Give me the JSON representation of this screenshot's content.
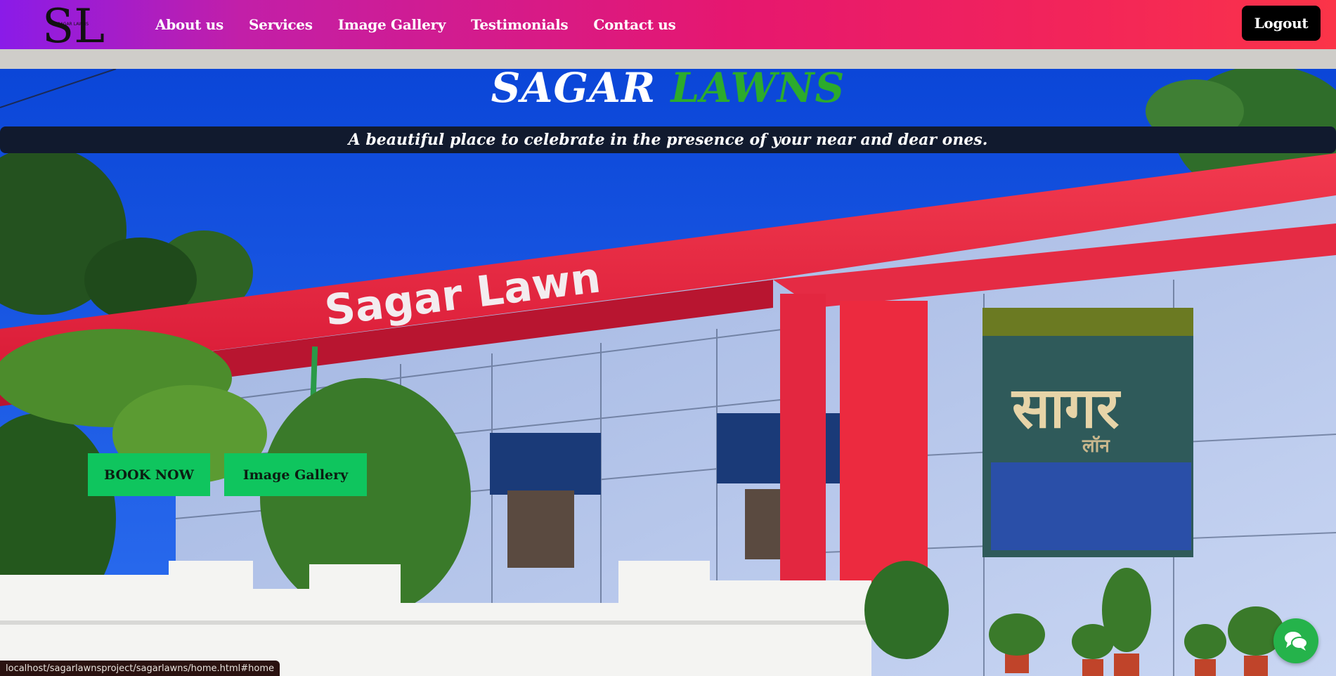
{
  "brand": {
    "logo_letters": "SL",
    "logo_text": "SAGAR LAWNS"
  },
  "nav": {
    "links": [
      "About us",
      "Services",
      "Image Gallery",
      "Testimonials",
      "Contact us"
    ],
    "logout_label": "Logout"
  },
  "hero": {
    "title_part1": "SAGAR",
    "title_part2": "LAWNS",
    "tagline": "A beautiful place to celebrate in the presence of your near and dear ones.",
    "building_sign": "Sagar Lawn",
    "hindi_sign_main": "सागर",
    "hindi_sign_sub": "लॉन",
    "book_label": "BOOK NOW",
    "gallery_label": "Image Gallery"
  },
  "status_bar": {
    "url": "localhost/sagarlawnsproject/sagarlawns/home.html#home"
  },
  "chat": {
    "icon": "chat-bubbles-icon"
  },
  "colors": {
    "accent_green": "#2cab2c",
    "button_green": "#0fc55e",
    "nav_gradient_start": "#8a1be8",
    "nav_gradient_end": "#fb3448",
    "tagline_bg": "#111a2e"
  }
}
